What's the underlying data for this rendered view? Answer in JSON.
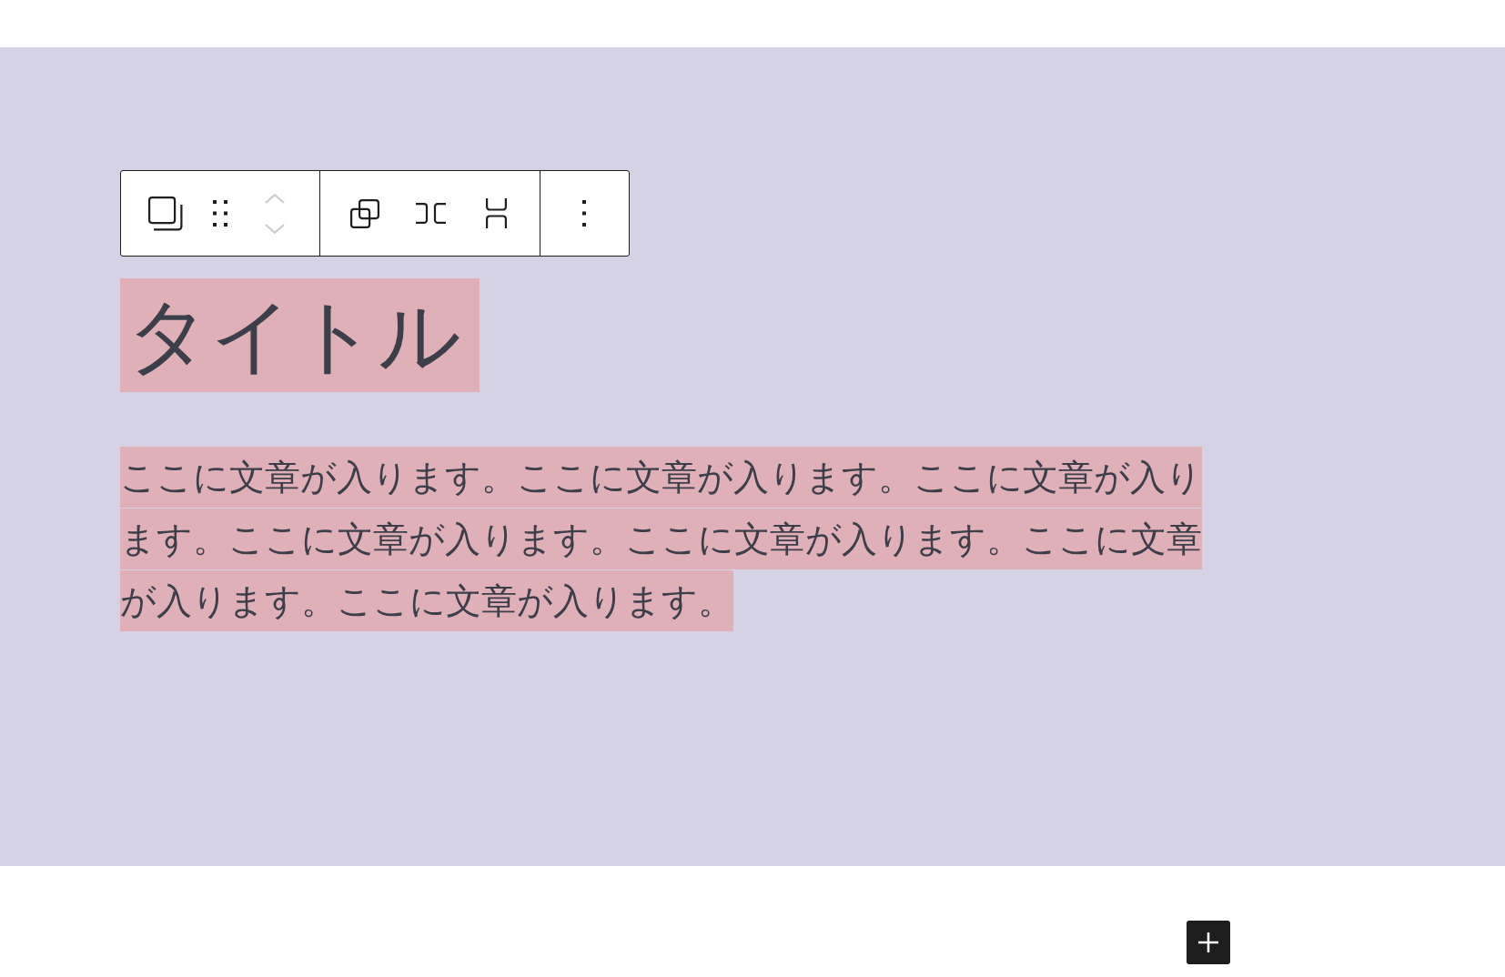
{
  "block_toolbar": {
    "groups": [
      {
        "buttons": [
          {
            "kind": "block-type"
          },
          {
            "kind": "drag"
          },
          {
            "kind": "mover",
            "buttons": [
              {
                "kind": "up",
                "disabled": true
              },
              {
                "kind": "down",
                "disabled": true
              }
            ]
          }
        ]
      },
      {
        "buttons": [
          {
            "kind": "group"
          },
          {
            "kind": "row"
          },
          {
            "kind": "stack"
          }
        ]
      },
      {
        "buttons": [
          {
            "kind": "options"
          }
        ]
      }
    ]
  },
  "heading": "タイトル",
  "paragraph": "ここに文章が入ります。ここに文章が入ります。ここに文章が入ります。ここに文章が入ります。ここに文章が入ります。ここに文章が入ります。ここに文章が入ります。"
}
